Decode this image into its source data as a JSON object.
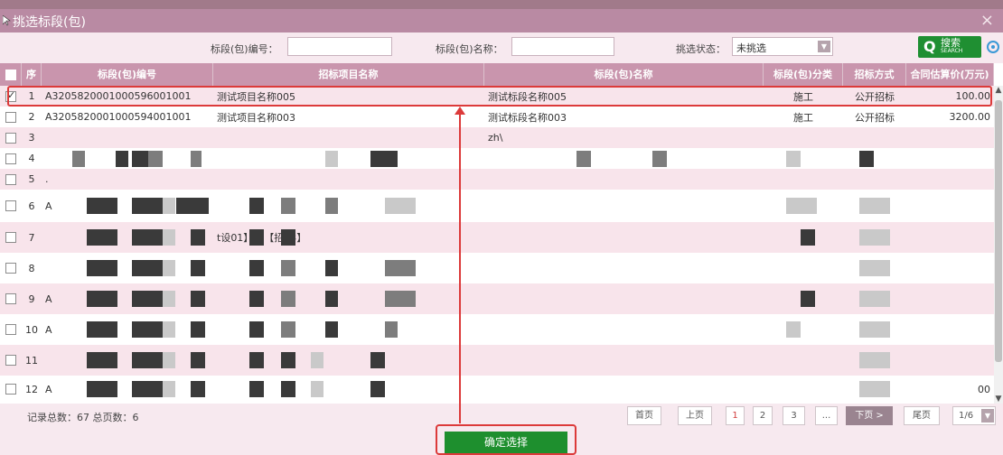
{
  "dialog": {
    "title": "挑选标段(包)",
    "close_label": "×"
  },
  "filters": {
    "code_label": "标段(包)编号：",
    "code_value": "",
    "name_label": "标段(包)名称：",
    "name_value": "",
    "status_label": "挑选状态：",
    "status_value": "未挑选",
    "search_label": "搜索",
    "search_sub": "SEARCH"
  },
  "table": {
    "headers": [
      "序",
      "标段(包)编号",
      "招标项目名称",
      "标段(包)名称",
      "标段(包)分类",
      "招标方式",
      "合同估算价(万元)"
    ],
    "rows": [
      {
        "no": "1",
        "checked": true,
        "code": "A3205820001000596001001",
        "project": "测试项目名称005",
        "name": "测试标段名称005",
        "category": "施工",
        "method": "公开招标",
        "price": "100.00"
      },
      {
        "no": "2",
        "checked": false,
        "code": "A3205820001000594001001",
        "project": "测试项目名称003",
        "name": "测试标段名称003",
        "category": "施工",
        "method": "公开招标",
        "price": "3200.00"
      },
      {
        "no": "3",
        "checked": false,
        "code": "",
        "project": "",
        "name": "zh\\",
        "category": "",
        "method": "",
        "price": ""
      },
      {
        "no": "4",
        "checked": false,
        "code": "",
        "project": "",
        "name": "",
        "category": "",
        "method": "",
        "price": ""
      },
      {
        "no": "5",
        "checked": false,
        "code": ".",
        "project": "",
        "name": "",
        "category": "",
        "method": "",
        "price": ""
      },
      {
        "no": "6",
        "checked": false,
        "code": "A",
        "project": "",
        "name": "",
        "category": "",
        "method": "",
        "price": ""
      },
      {
        "no": "7",
        "checked": false,
        "code": "",
        "project": "t设01】---【招03】",
        "name": "",
        "category": "",
        "method": "",
        "price": ""
      },
      {
        "no": "8",
        "checked": false,
        "code": "",
        "project": "",
        "name": "",
        "category": "",
        "method": "",
        "price": ""
      },
      {
        "no": "9",
        "checked": false,
        "code": "A",
        "project": "",
        "name": "",
        "category": "",
        "method": "",
        "price": ""
      },
      {
        "no": "10",
        "checked": false,
        "code": "A",
        "project": "",
        "name": "",
        "category": "",
        "method": "",
        "price": ""
      },
      {
        "no": "11",
        "checked": false,
        "code": "",
        "project": "",
        "name": "",
        "category": "",
        "method": "",
        "price": ""
      },
      {
        "no": "12",
        "checked": false,
        "code": "A",
        "project": "",
        "name": "",
        "category": "",
        "method": "",
        "price": "00"
      }
    ]
  },
  "footer": {
    "summary": "记录总数：67   总页数：6",
    "first": "首页",
    "prev": "上页",
    "pages": [
      "1",
      "2",
      "3",
      "..."
    ],
    "next": "下页 >",
    "last": "尾页",
    "page_select": "1/6",
    "confirm": "确定选择"
  }
}
